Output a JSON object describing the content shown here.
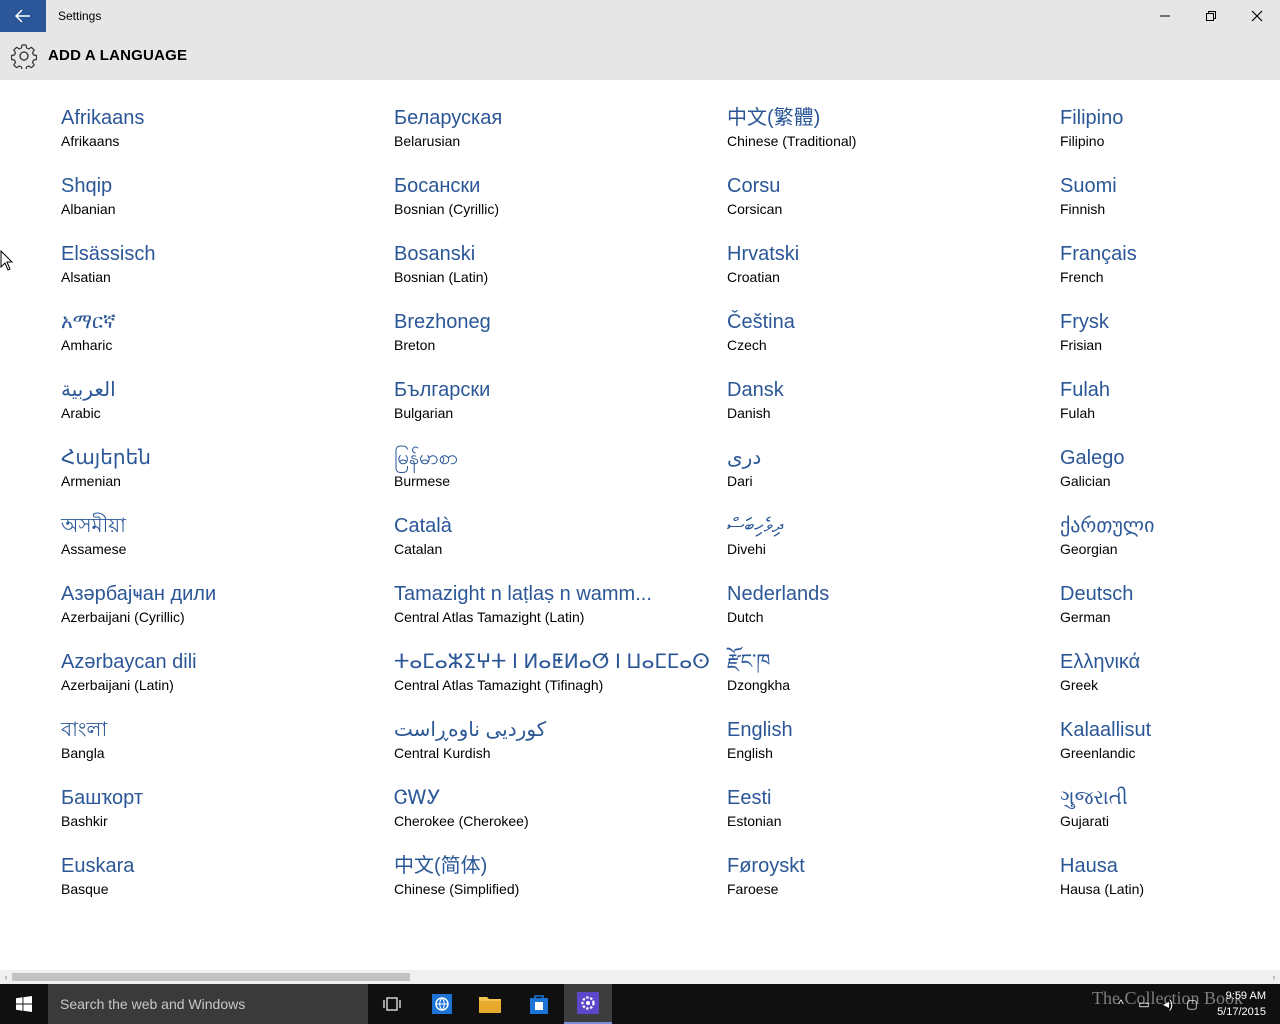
{
  "window": {
    "title": "Settings"
  },
  "header": {
    "title": "ADD A LANGUAGE"
  },
  "columns": [
    [
      {
        "native": "Afrikaans",
        "english": "Afrikaans"
      },
      {
        "native": "Shqip",
        "english": "Albanian"
      },
      {
        "native": "Elsässisch",
        "english": "Alsatian"
      },
      {
        "native": "አማርኛ",
        "english": "Amharic"
      },
      {
        "native": "العربية",
        "english": "Arabic"
      },
      {
        "native": "Հայերեն",
        "english": "Armenian"
      },
      {
        "native": "অসমীয়া",
        "english": "Assamese"
      },
      {
        "native": "Азәрбајҹан дили",
        "english": "Azerbaijani (Cyrillic)"
      },
      {
        "native": "Azərbaycan dili",
        "english": "Azerbaijani (Latin)"
      },
      {
        "native": "বাংলা",
        "english": "Bangla"
      },
      {
        "native": "Башҡорт",
        "english": "Bashkir"
      },
      {
        "native": "Euskara",
        "english": "Basque"
      }
    ],
    [
      {
        "native": "Беларуская",
        "english": "Belarusian"
      },
      {
        "native": "Босански",
        "english": "Bosnian (Cyrillic)"
      },
      {
        "native": "Bosanski",
        "english": "Bosnian (Latin)"
      },
      {
        "native": "Brezhoneg",
        "english": "Breton"
      },
      {
        "native": "Български",
        "english": "Bulgarian"
      },
      {
        "native": "မြန်မာစာ",
        "english": "Burmese"
      },
      {
        "native": "Català",
        "english": "Catalan"
      },
      {
        "native": "Tamazight n laṭlaṣ n wamm...",
        "english": "Central Atlas Tamazight (Latin)"
      },
      {
        "native": "ⵜⴰⵎⴰⵣⵉⵖⵜ ⵏ ⵍⴰⵟⵍⴰⵚ ⵏ ⵡⴰⵎⵎⴰⵙ",
        "english": "Central Atlas Tamazight (Tifinagh)"
      },
      {
        "native": "کوردیی ناوەڕاست",
        "english": "Central Kurdish"
      },
      {
        "native": "ᏣᎳᎩ",
        "english": "Cherokee (Cherokee)"
      },
      {
        "native": "中文(简体)",
        "english": "Chinese (Simplified)"
      }
    ],
    [
      {
        "native": "中文(繁體)",
        "english": "Chinese (Traditional)"
      },
      {
        "native": "Corsu",
        "english": "Corsican"
      },
      {
        "native": "Hrvatski",
        "english": "Croatian"
      },
      {
        "native": "Čeština",
        "english": "Czech"
      },
      {
        "native": "Dansk",
        "english": "Danish"
      },
      {
        "native": "درى",
        "english": "Dari"
      },
      {
        "native": "ދިވެހިބަސް",
        "english": "Divehi"
      },
      {
        "native": "Nederlands",
        "english": "Dutch"
      },
      {
        "native": "རྫོང་ཁ",
        "english": "Dzongkha"
      },
      {
        "native": "English",
        "english": "English"
      },
      {
        "native": "Eesti",
        "english": "Estonian"
      },
      {
        "native": "Føroyskt",
        "english": "Faroese"
      }
    ],
    [
      {
        "native": "Filipino",
        "english": "Filipino"
      },
      {
        "native": "Suomi",
        "english": "Finnish"
      },
      {
        "native": "Français",
        "english": "French"
      },
      {
        "native": "Frysk",
        "english": "Frisian"
      },
      {
        "native": "Fulah",
        "english": "Fulah"
      },
      {
        "native": "Galego",
        "english": "Galician"
      },
      {
        "native": "ქართული",
        "english": "Georgian"
      },
      {
        "native": "Deutsch",
        "english": "German"
      },
      {
        "native": "Ελληνικά",
        "english": "Greek"
      },
      {
        "native": "Kalaallisut",
        "english": "Greenlandic"
      },
      {
        "native": "ગુજરાતી",
        "english": "Gujarati"
      },
      {
        "native": "Hausa",
        "english": "Hausa (Latin)"
      }
    ]
  ],
  "taskbar": {
    "search_placeholder": "Search the web and Windows",
    "time": "9:59 AM",
    "date": "5/17/2015",
    "watermark": "The Collection Book"
  },
  "icons": {
    "back": "back-arrow-icon",
    "settings": "gear-icon",
    "minimize": "minimize-icon",
    "restore": "restore-icon",
    "close": "close-icon"
  },
  "colors": {
    "accent": "#2b579a",
    "native_text": "#2b5797",
    "chrome": "#e6e6e6",
    "taskbar": "#101010"
  }
}
